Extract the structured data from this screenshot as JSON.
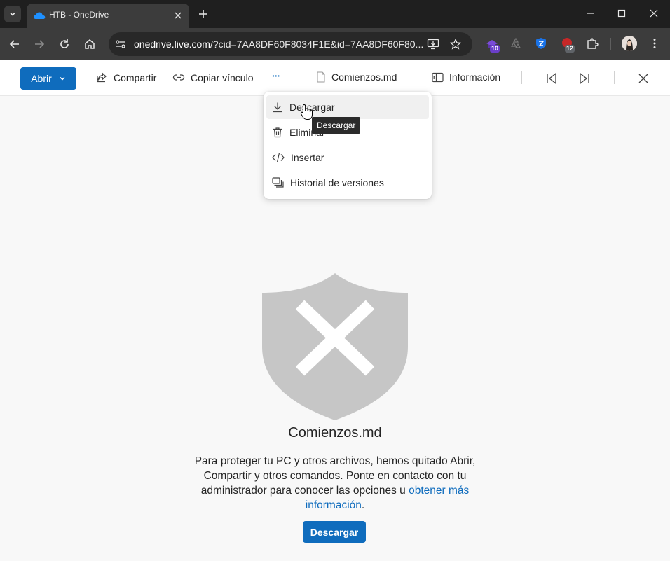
{
  "browser": {
    "tab_title": "HTB - OneDrive",
    "url_host": "onedrive.live.com",
    "url_rest": "/?cid=7AA8DF60F8034F1E&id=7AA8DF60F80...",
    "ext_badge_1": "10",
    "ext_badge_2": "12"
  },
  "cmdbar": {
    "open_label": "Abrir",
    "share_label": "Compartir",
    "copy_link_label": "Copiar vínculo",
    "more_label": "···",
    "file_name": "Comienzos.md",
    "info_label": "Información"
  },
  "menu": {
    "items": [
      {
        "label": "Descargar",
        "icon": "download-icon"
      },
      {
        "label": "Eliminar",
        "icon": "trash-icon"
      },
      {
        "label": "Insertar",
        "icon": "code-icon"
      },
      {
        "label": "Historial de versiones",
        "icon": "version-history-icon"
      }
    ],
    "tooltip": "Descargar"
  },
  "main": {
    "file_name": "Comienzos.md",
    "message_text": "Para proteger tu PC y otros archivos, hemos quitado Abrir, Compartir y otros comandos. Ponte en contacto con tu administrador para conocer las opciones u ",
    "message_link": "obtener más información",
    "message_end": ".",
    "download_button": "Descargar"
  },
  "colors": {
    "accent": "#0f6cbd",
    "shield": "#c6c6c6"
  }
}
